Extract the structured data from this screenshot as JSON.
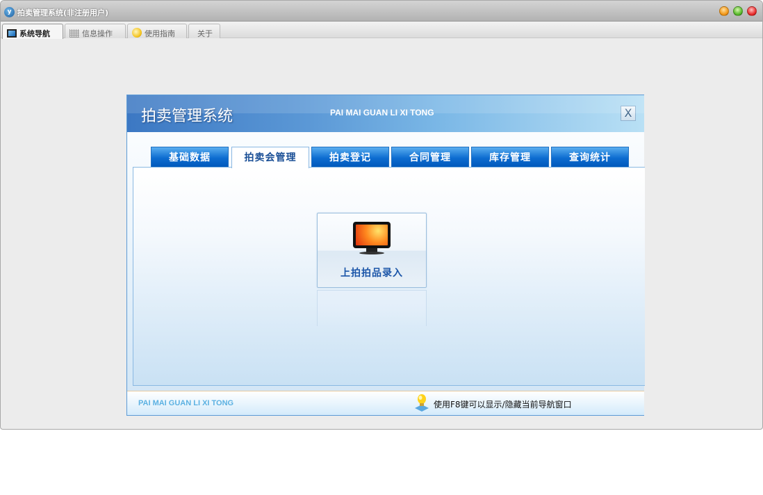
{
  "window": {
    "title": "拍卖管理系统(非注册用户)",
    "controls": [
      "minimize",
      "maximize",
      "close"
    ],
    "colors": {
      "minimize": "#f5a623",
      "maximize": "#4caf2a",
      "close": "#e8262a"
    }
  },
  "window_tabs": [
    {
      "label": "系统导航",
      "icon": "monitor-icon",
      "active": true
    },
    {
      "label": "信息操作",
      "icon": "grid-icon",
      "active": false
    },
    {
      "label": "使用指南",
      "icon": "help-icon",
      "active": false
    },
    {
      "label": "关于",
      "icon": "",
      "active": false
    }
  ],
  "panel": {
    "title": "拍卖管理系统",
    "subtitle": "PAI MAI GUAN LI XI TONG",
    "close_label": "X",
    "tabs": [
      {
        "label": "基础数据",
        "active": false
      },
      {
        "label": "拍卖会管理",
        "active": true
      },
      {
        "label": "拍卖登记",
        "active": false
      },
      {
        "label": "合同管理",
        "active": false
      },
      {
        "label": "库存管理",
        "active": false
      },
      {
        "label": "查询统计",
        "active": false
      }
    ],
    "cards": [
      {
        "label": "上拍拍品录入",
        "icon": "monitor-icon"
      }
    ],
    "footer": {
      "subtitle": "PAI MAI GUAN LI XI TONG",
      "tip": "使用F8键可以显示/隐藏当前导航窗口"
    }
  }
}
